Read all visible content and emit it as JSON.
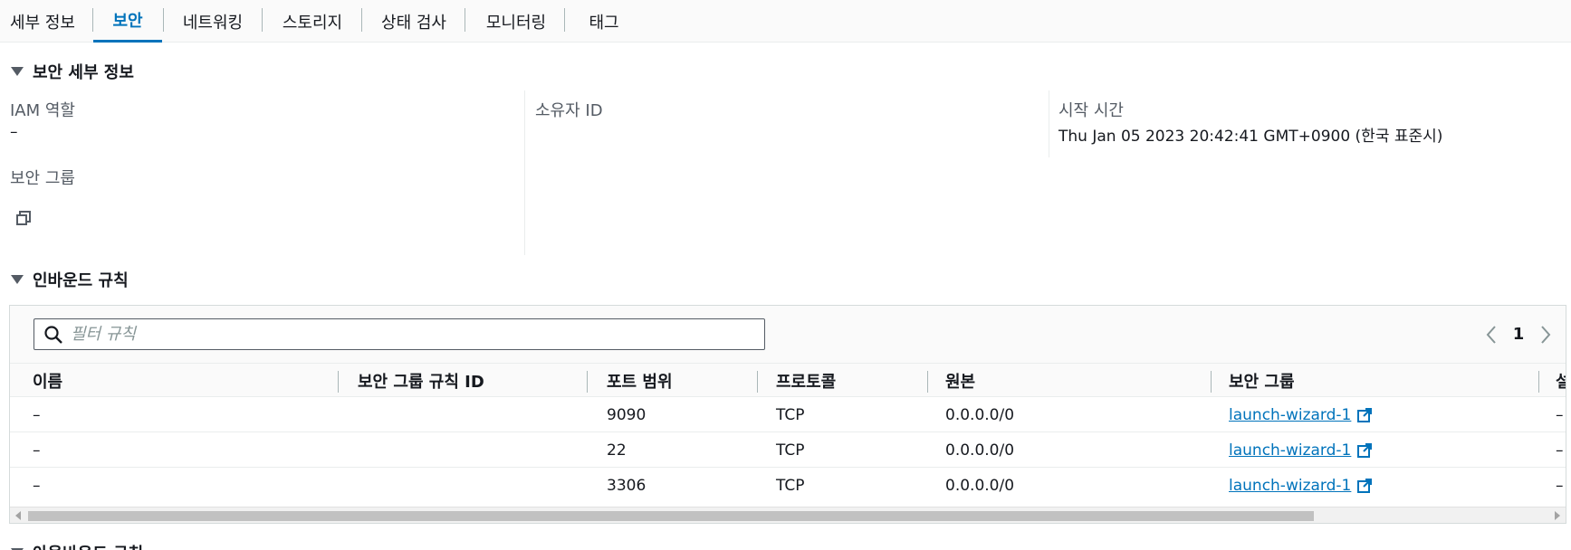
{
  "tabs": [
    {
      "label": "세부 정보",
      "active": false
    },
    {
      "label": "보안",
      "active": true
    },
    {
      "label": "네트워킹",
      "active": false
    },
    {
      "label": "스토리지",
      "active": false
    },
    {
      "label": "상태 검사",
      "active": false
    },
    {
      "label": "모니터링",
      "active": false
    },
    {
      "label": "태그",
      "active": false
    }
  ],
  "security_details": {
    "title": "보안 세부 정보",
    "iam_role_label": "IAM 역할",
    "iam_role_value": "–",
    "owner_id_label": "소유자 ID",
    "owner_id_value": "",
    "start_time_label": "시작 시간",
    "start_time_value": "Thu Jan 05 2023 20:42:41 GMT+0900 (한국 표준시)",
    "security_groups_label": "보안 그룹",
    "copy_icon": "copy-icon"
  },
  "inbound": {
    "title": "인바운드 규칙",
    "search_placeholder": "필터 규칙",
    "page": "1",
    "columns": [
      "이름",
      "보안 그룹 규칙 ID",
      "포트 범위",
      "프로토콜",
      "원본",
      "보안 그룹",
      "설"
    ],
    "rows": [
      {
        "name": "–",
        "rule_id": "",
        "port": "9090",
        "protocol": "TCP",
        "source": "0.0.0.0/0",
        "sg": "launch-wizard-1",
        "extra": "–"
      },
      {
        "name": "–",
        "rule_id": "",
        "port": "22",
        "protocol": "TCP",
        "source": "0.0.0.0/0",
        "sg": "launch-wizard-1",
        "extra": "–"
      },
      {
        "name": "–",
        "rule_id": "",
        "port": "3306",
        "protocol": "TCP",
        "source": "0.0.0.0/0",
        "sg": "launch-wizard-1",
        "extra": "–"
      }
    ]
  },
  "outbound": {
    "title": "아웃바운드 규칙"
  },
  "colors": {
    "link": "#0073bb",
    "active_tab": "#0073bb",
    "text": "#16191f",
    "muted": "#545b64"
  }
}
